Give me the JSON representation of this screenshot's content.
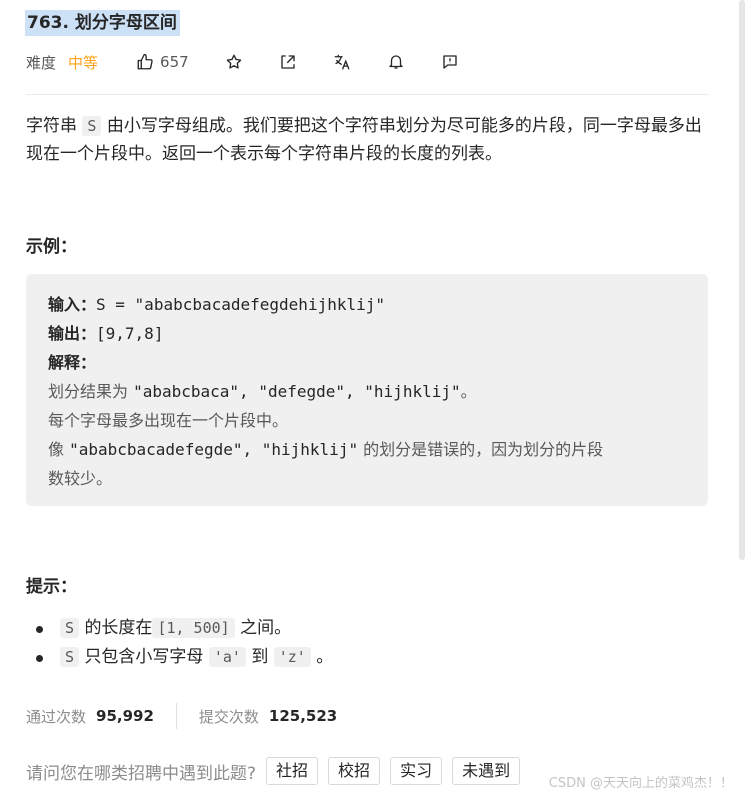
{
  "problem": {
    "title": "763. 划分字母区间",
    "difficulty_label": "难度",
    "difficulty": "中等",
    "likes": "657"
  },
  "colors": {
    "accent": "#ffa116",
    "highlight": "#cce1f6"
  },
  "icons": [
    "thumbs-up-icon",
    "star-icon",
    "share-icon",
    "translate-icon",
    "bell-icon",
    "feedback-icon"
  ],
  "description": {
    "p1_before": "字符串 ",
    "var_s": "S",
    "p1_after": " 由小写字母组成。我们要把这个字符串划分为尽可能多的片段，同一字母最多出现在一个片段中。返回一个表示每个字符串片段的长度的列表。"
  },
  "example_heading": "示例：",
  "example": {
    "input_label": "输入：",
    "input_value": "S = \"ababcbacadefegdehijhklij\"",
    "output_label": "输出：",
    "output_value": "[9,7,8]",
    "explain_label": "解释：",
    "line1_a": "划分结果为 ",
    "line1_b": "\"ababcbaca\", \"defegde\", \"hijhklij\"",
    "line1_c": "。",
    "line2": "每个字母最多出现在一个片段中。",
    "line3_a": "像 ",
    "line3_b": "\"ababcbacadefegde\", \"hijhklij\"",
    "line3_c": " 的划分是错误的，因为划分的片段",
    "line4": "数较少。"
  },
  "hints_heading": "提示：",
  "hints": {
    "h1_var": "S",
    "h1_a": "的长度在",
    "h1_range": "[1, 500]",
    "h1_b": "之间。",
    "h2_var": "S",
    "h2_a": "只包含小写字母",
    "h2_q1": "'a'",
    "h2_to": "到",
    "h2_q2": "'z'",
    "h2_end": "。"
  },
  "stats": {
    "accepted_label": "通过次数",
    "accepted": "95,992",
    "submissions_label": "提交次数",
    "submissions": "125,523"
  },
  "job": {
    "question": "请问您在哪类招聘中遇到此题?",
    "tags": [
      "社招",
      "校招",
      "实习",
      "未遇到"
    ]
  },
  "watermark": "CSDN @天天向上的菜鸡杰！！"
}
